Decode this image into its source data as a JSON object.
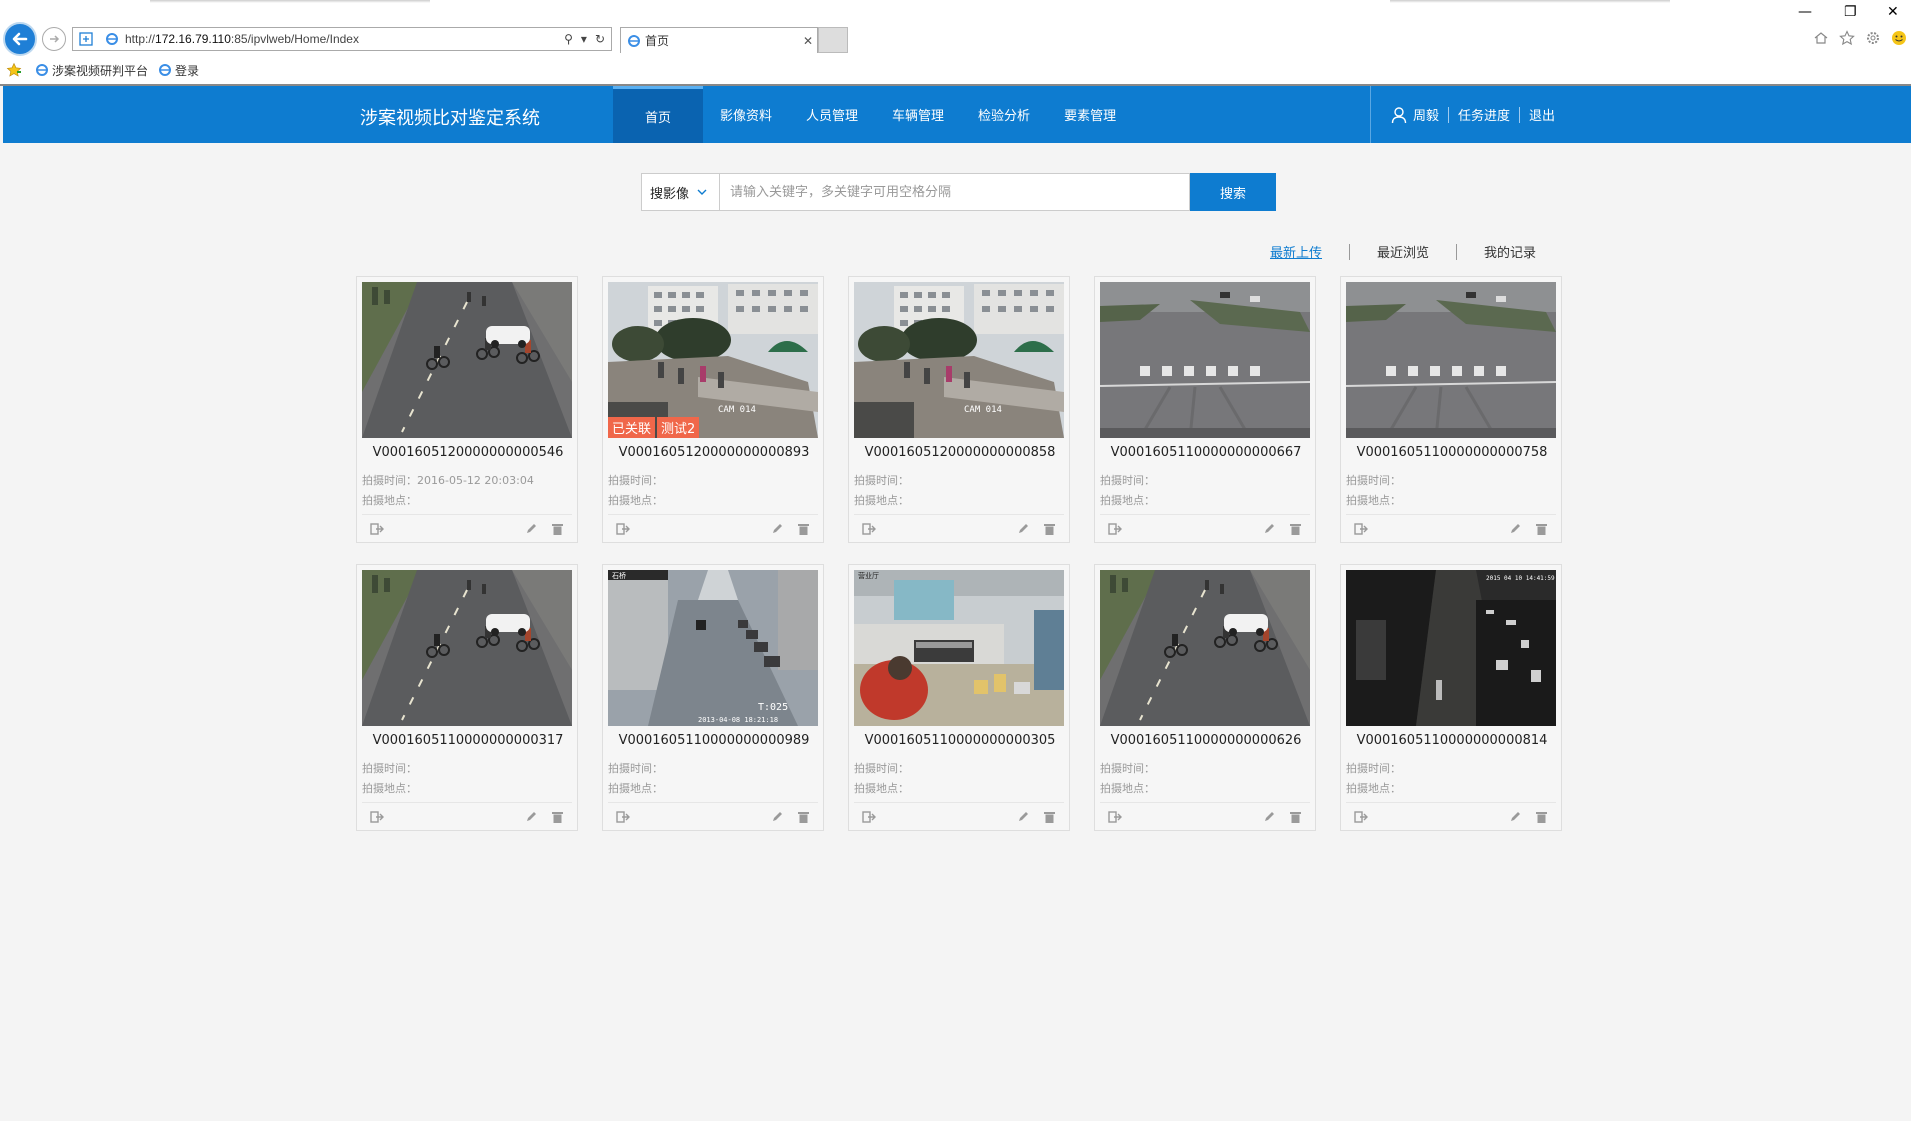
{
  "browser": {
    "url_prefix": "http://",
    "url_host": "172.16.79.110",
    "url_rest": ":85/ipvlweb/Home/Index",
    "tab_title": "首页",
    "favorites": [
      {
        "label": "涉案视频研判平台"
      },
      {
        "label": "登录"
      }
    ]
  },
  "header": {
    "brand": "涉案视频比对鉴定系统",
    "nav": [
      {
        "label": "首页",
        "active": true
      },
      {
        "label": "影像资料"
      },
      {
        "label": "人员管理"
      },
      {
        "label": "车辆管理"
      },
      {
        "label": "检验分析"
      },
      {
        "label": "要素管理"
      }
    ],
    "user": "周毅",
    "task_progress": "任务进度",
    "logout": "退出"
  },
  "search": {
    "type_label": "搜影像",
    "placeholder": "请输入关键字，多关键字可用空格分隔",
    "button": "搜索"
  },
  "sort_tabs": [
    {
      "label": "最新上传",
      "active": true
    },
    {
      "label": "最近浏览"
    },
    {
      "label": "我的记录"
    }
  ],
  "labels": {
    "time": "拍摄时间：",
    "location": "拍摄地点："
  },
  "videos": [
    {
      "id": "V0001605120000000000546",
      "time": "2016-05-12 20:03:04",
      "location": "",
      "scene": "road-bikes",
      "badges": []
    },
    {
      "id": "V0001605120000000000893",
      "time": "",
      "location": "",
      "scene": "bridge",
      "badges": [
        "已关联",
        "测试2"
      ]
    },
    {
      "id": "V0001605120000000000858",
      "time": "",
      "location": "",
      "scene": "bridge",
      "badges": []
    },
    {
      "id": "V0001605110000000000667",
      "time": "",
      "location": "",
      "scene": "crosswalk",
      "badges": []
    },
    {
      "id": "V0001605110000000000758",
      "time": "",
      "location": "",
      "scene": "crosswalk",
      "badges": []
    },
    {
      "id": "V0001605110000000000317",
      "time": "",
      "location": "",
      "scene": "road-bikes",
      "badges": []
    },
    {
      "id": "V0001605110000000000989",
      "time": "",
      "location": "",
      "scene": "street",
      "badges": []
    },
    {
      "id": "V0001605110000000000305",
      "time": "",
      "location": "",
      "scene": "counter",
      "badges": []
    },
    {
      "id": "V0001605110000000000626",
      "time": "",
      "location": "",
      "scene": "road-bikes",
      "badges": []
    },
    {
      "id": "V0001605110000000000814",
      "time": "",
      "location": "",
      "scene": "night",
      "badges": []
    }
  ],
  "colors": {
    "primary": "#0e7cd0",
    "badge": "#f0674a"
  }
}
